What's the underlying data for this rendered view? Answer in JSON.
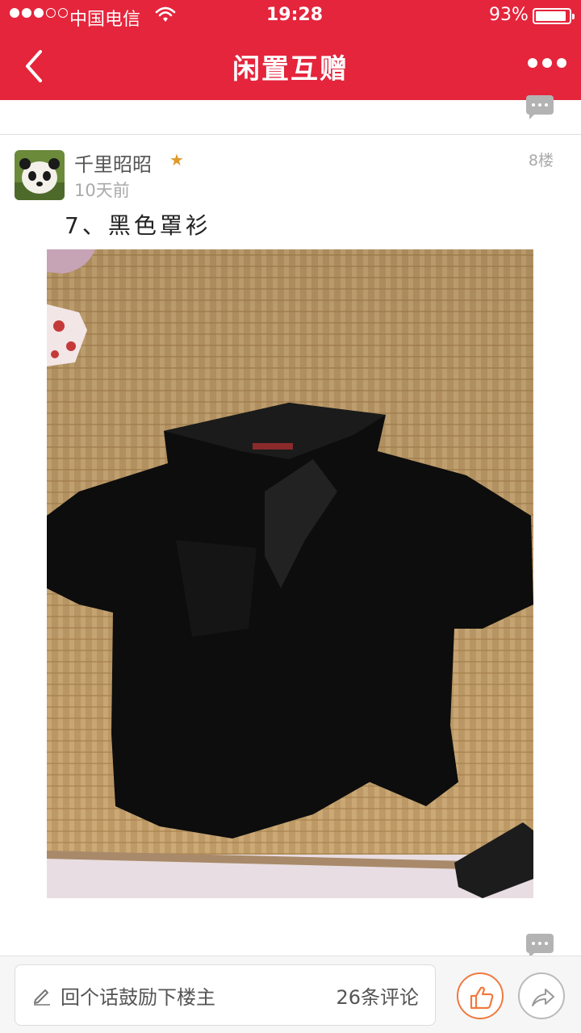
{
  "status_bar": {
    "carrier": "中国电信",
    "time": "19:28",
    "battery": "93%",
    "battery_level": 0.93
  },
  "nav": {
    "title": "闲置互赠"
  },
  "post": {
    "username": "千里昭昭",
    "time": "10天前",
    "floor": "8楼",
    "text": "7、黑色罩衫"
  },
  "reply_bar": {
    "placeholder": "回个话鼓励下楼主",
    "comment_count": "26条评论"
  },
  "icons": {
    "back": "chevron-left-icon",
    "more": "more-dots-icon",
    "comment": "comment-bubble-icon",
    "star": "star-icon",
    "pencil": "pencil-icon",
    "like": "thumbs-up-icon",
    "share": "share-arrow-icon"
  },
  "colors": {
    "brand": "#e4253c",
    "like_accent": "#f07a3e"
  }
}
